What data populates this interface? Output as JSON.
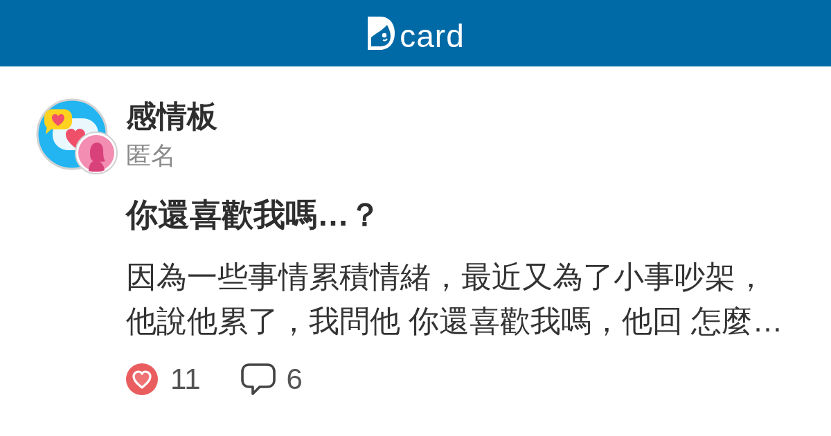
{
  "header": {
    "logo_text": "card"
  },
  "board": {
    "name": "感情板"
  },
  "author": {
    "name": "匿名"
  },
  "post": {
    "title": "你還喜歡我嗎…？",
    "excerpt": "因為一些事情累積情緒，最近又為了小事吵架，他說他累了，我問他 你還喜歡我嗎，他回 怎麼…"
  },
  "stats": [
    {
      "kind": "likes",
      "count": "11"
    },
    {
      "kind": "comments",
      "count": "6"
    }
  ]
}
